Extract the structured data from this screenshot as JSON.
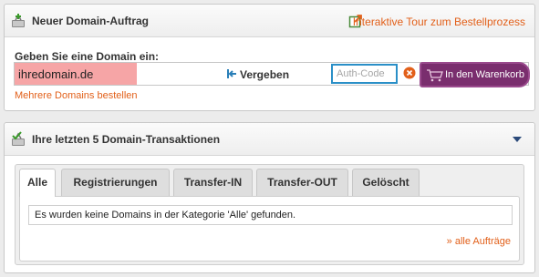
{
  "order_panel": {
    "title": "Neuer Domain-Auftrag",
    "tour_link": "Interaktive Tour zum Bestellprozess",
    "form_label": "Geben Sie eine Domain ein:",
    "domain_value": "ihredomain.de",
    "status_label": "Vergeben",
    "auth_placeholder": "Auth-Code",
    "cart_button": "In den Warenkorb",
    "multi_link": "Mehrere Domains bestellen",
    "colors": {
      "link": "#e2601a",
      "taken_field": "#f6a5a6",
      "cart_button": "#7a2e6e",
      "auth_border": "#2a8fc7"
    }
  },
  "tx_panel": {
    "title": "Ihre letzten 5 Domain-Transaktionen",
    "tabs": [
      {
        "label": "Alle",
        "active": true
      },
      {
        "label": "Registrierungen",
        "active": false
      },
      {
        "label": "Transfer-IN",
        "active": false
      },
      {
        "label": "Transfer-OUT",
        "active": false
      },
      {
        "label": "Gelöscht",
        "active": false
      }
    ],
    "empty_message": "Es wurden keine Domains in der Kategorie 'Alle' gefunden.",
    "all_orders_link": "» alle Aufträge"
  }
}
